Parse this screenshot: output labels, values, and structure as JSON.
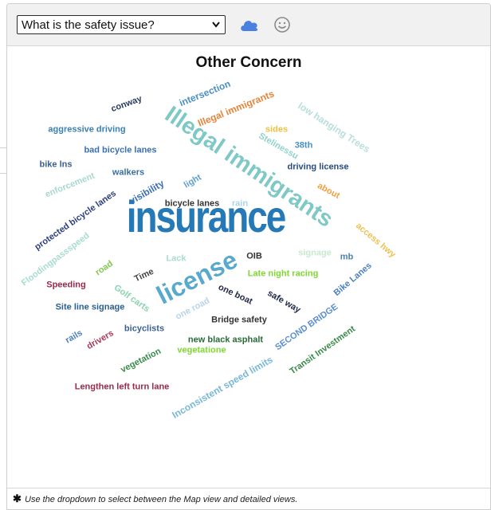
{
  "toolbar": {
    "select": {
      "value": "What is the safety issue?"
    },
    "cloud_button_icon": "cloud-icon",
    "smile_button_icon": "smiley-face-icon"
  },
  "wordcloud": {
    "title": "Other Concern",
    "words": [
      {
        "text": "insurance",
        "color": "#2479b6"
      },
      {
        "text": "Illegal immigrants",
        "color": "#7ec8c6"
      },
      {
        "text": "license",
        "color": "#59a9cf"
      },
      {
        "text": "conway",
        "color": "#2b3a5c"
      },
      {
        "text": "intersection",
        "color": "#4a8fc2"
      },
      {
        "text": "Illegal immigrants",
        "color": "#e8833a"
      },
      {
        "text": "low hanging Trees",
        "color": "#b8e0dc"
      },
      {
        "text": "aggressive driving",
        "color": "#3a7fb2"
      },
      {
        "text": "sides",
        "color": "#f0c040"
      },
      {
        "text": "Stelinessu",
        "color": "#8fd4cc"
      },
      {
        "text": "38th",
        "color": "#4a8fc2"
      },
      {
        "text": "bad bicycle lanes",
        "color": "#3a6fb2"
      },
      {
        "text": "bike lns",
        "color": "#3a5f92"
      },
      {
        "text": "walkers",
        "color": "#3a6fa2"
      },
      {
        "text": "driving license",
        "color": "#2a4a82"
      },
      {
        "text": "enforcement",
        "color": "#a8d8d0"
      },
      {
        "text": "light",
        "color": "#5fa0d0"
      },
      {
        "text": "about",
        "color": "#f0a040"
      },
      {
        "text": "visibility",
        "color": "#3a6fb2"
      },
      {
        "text": "protected bicycle lanes",
        "color": "#2a3e7a"
      },
      {
        "text": "bicycle lanes",
        "color": "#333333"
      },
      {
        "text": "rain",
        "color": "#aad6ea"
      },
      {
        "text": "Floodingpassspeed",
        "color": "#a8dcd0"
      },
      {
        "text": "road",
        "color": "#7ec850"
      },
      {
        "text": "signage",
        "color": "#c8e8d0"
      },
      {
        "text": "access hwy",
        "color": "#f0c050"
      },
      {
        "text": "Lack",
        "color": "#a8dcd0"
      },
      {
        "text": "OIB",
        "color": "#333333"
      },
      {
        "text": "mb",
        "color": "#4a7fb2"
      },
      {
        "text": "Time",
        "color": "#444444"
      },
      {
        "text": "Late night racing",
        "color": "#7ed830"
      },
      {
        "text": "Bike Lanes",
        "color": "#4a7fc2"
      },
      {
        "text": "Speeding",
        "color": "#9a2a4a"
      },
      {
        "text": "Golf carts",
        "color": "#8ad4b0"
      },
      {
        "text": "one boat",
        "color": "#222a4a"
      },
      {
        "text": "safe way",
        "color": "#222a4a"
      },
      {
        "text": "Site line signage",
        "color": "#2a5f92"
      },
      {
        "text": "one road",
        "color": "#b8d4e8"
      },
      {
        "text": "Bridge safety",
        "color": "#333333"
      },
      {
        "text": "SECOND BRIDGE",
        "color": "#5a8fd0"
      },
      {
        "text": "rails",
        "color": "#4a7fc2"
      },
      {
        "text": "drivers",
        "color": "#a83a5a"
      },
      {
        "text": "bicyclists",
        "color": "#3a5f92"
      },
      {
        "text": "new black asphalt",
        "color": "#2a6a3a"
      },
      {
        "text": "vegetatione",
        "color": "#7ed830"
      },
      {
        "text": "Transit Investment",
        "color": "#3a8a4a"
      },
      {
        "text": "vegetation",
        "color": "#3a8a4a"
      },
      {
        "text": "Inconsistent speed limits",
        "color": "#7ab8d8"
      },
      {
        "text": "Lengthen left turn lane",
        "color": "#9a2a4a"
      }
    ]
  },
  "footer": {
    "star": "✱",
    "note": "Use the dropdown to select between the Map view and detailed views."
  }
}
